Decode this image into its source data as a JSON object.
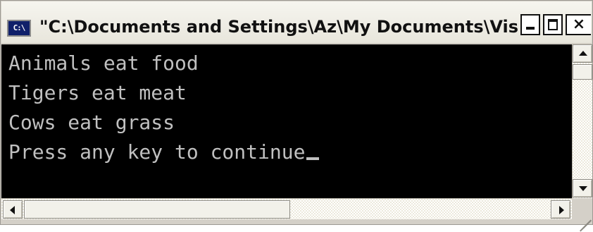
{
  "window": {
    "title": "\"C:\\Documents and Settings\\Az\\My Documents\\Visua...",
    "icon": "console-app-icon",
    "icon_text": "C:\\",
    "controls": {
      "minimize_icon": "minimize-icon",
      "maximize_icon": "maximize-icon",
      "close_icon": "close-icon",
      "close_glyph": "×"
    }
  },
  "console": {
    "background": "#000000",
    "foreground": "#c0c0c0",
    "lines": [
      "Animals eat food",
      "Tigers eat meat",
      "Cows eat grass",
      "Press any key to continue"
    ]
  },
  "scrollbars": {
    "vertical": {
      "up_icon": "scroll-up-arrow-icon",
      "down_icon": "scroll-down-arrow-icon"
    },
    "horizontal": {
      "left_icon": "scroll-left-arrow-icon",
      "right_icon": "scroll-right-arrow-icon"
    }
  }
}
